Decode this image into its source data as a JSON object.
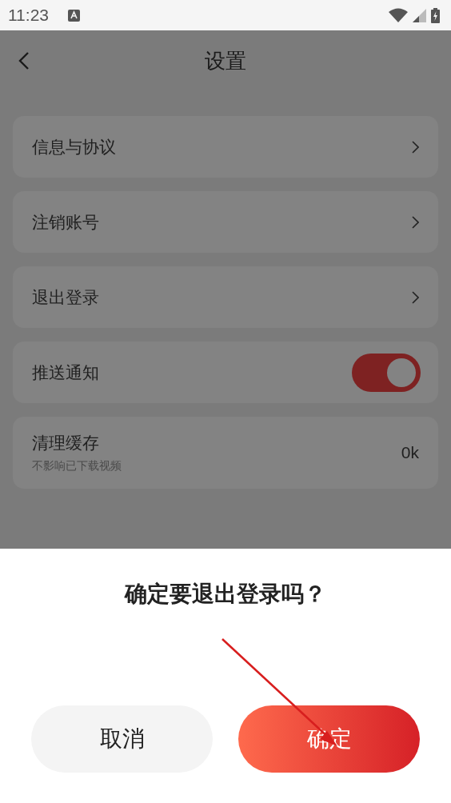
{
  "status_bar": {
    "time": "11:23"
  },
  "header": {
    "title": "设置"
  },
  "settings": [
    {
      "kind": "link",
      "label": "信息与协议"
    },
    {
      "kind": "link",
      "label": "注销账号"
    },
    {
      "kind": "link",
      "label": "退出登录"
    },
    {
      "kind": "toggle",
      "label": "推送通知",
      "on": true
    },
    {
      "kind": "value",
      "label": "清理缓存",
      "subtitle": "不影响已下载视频",
      "value": "0k"
    }
  ],
  "dialog": {
    "title": "确定要退出登录吗？",
    "buttons": [
      {
        "kind": "secondary",
        "label": "取消"
      },
      {
        "kind": "primary",
        "label": "确定"
      }
    ]
  }
}
